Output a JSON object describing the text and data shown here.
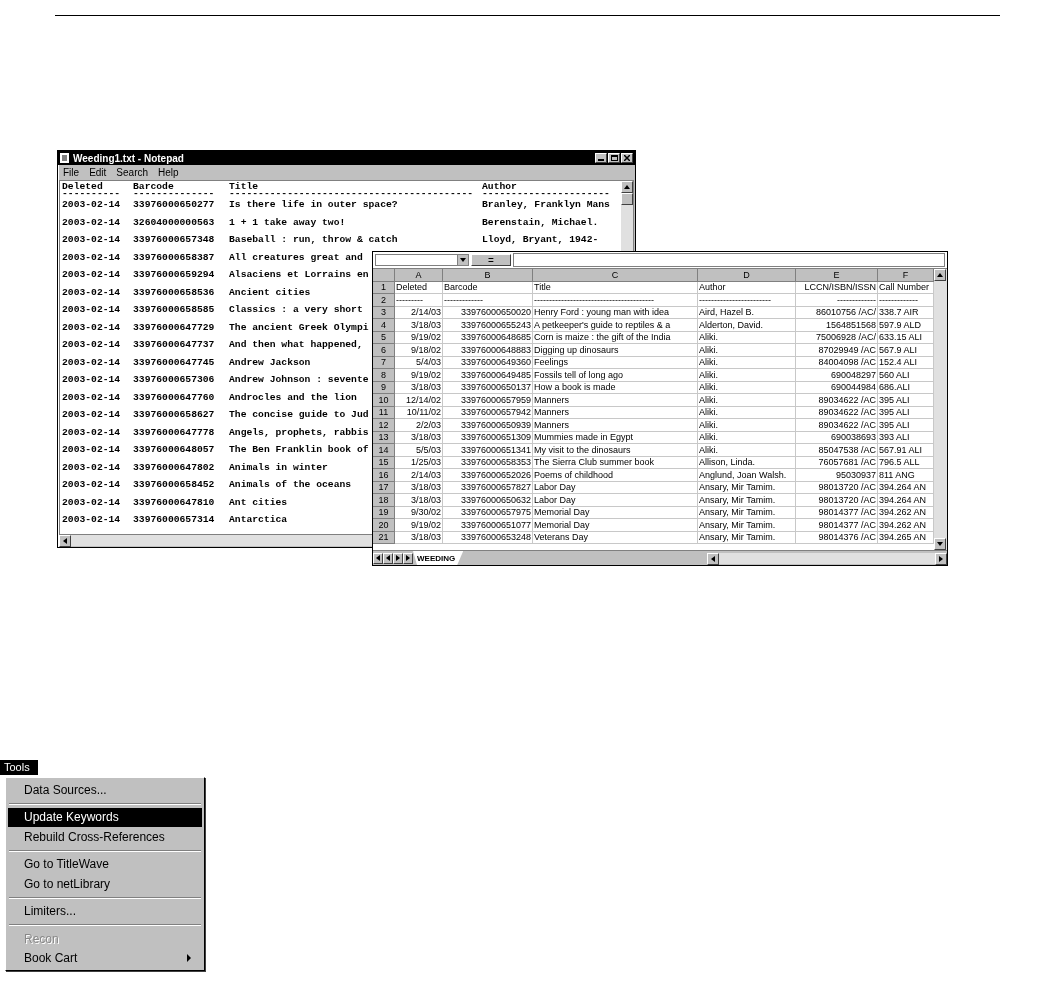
{
  "notepad": {
    "title": "Weeding1.txt - Notepad",
    "menu": [
      "File",
      "Edit",
      "Search",
      "Help"
    ],
    "columns": [
      {
        "label": "Deleted",
        "rule": "----------"
      },
      {
        "label": "Barcode",
        "rule": "--------------"
      },
      {
        "label": "Title",
        "rule": "------------------------------------------"
      },
      {
        "label": "Author",
        "rule": "----------------------"
      }
    ],
    "rows": [
      {
        "deleted": "2003-02-14",
        "barcode": "33976000650277",
        "title": "Is there life in outer space?",
        "author": "Branley, Franklyn Mans"
      },
      {
        "deleted": "2003-02-14",
        "barcode": "32604000000563",
        "title": "1 + 1 take away two!",
        "author": "Berenstain, Michael."
      },
      {
        "deleted": "2003-02-14",
        "barcode": "33976000657348",
        "title": "Baseball : run, throw & catch",
        "author": "Lloyd, Bryant, 1942-"
      },
      {
        "deleted": "2003-02-14",
        "barcode": "33976000658387",
        "title": "All creatures great and"
      },
      {
        "deleted": "2003-02-14",
        "barcode": "33976000659294",
        "title": "Alsaciens et Lorrains en"
      },
      {
        "deleted": "2003-02-14",
        "barcode": "33976000658536",
        "title": "Ancient cities"
      },
      {
        "deleted": "2003-02-14",
        "barcode": "33976000658585",
        "title": "Classics : a very short"
      },
      {
        "deleted": "2003-02-14",
        "barcode": "33976000647729",
        "title": "The ancient Greek Olympi"
      },
      {
        "deleted": "2003-02-14",
        "barcode": "33976000647737",
        "title": "And then what happened,"
      },
      {
        "deleted": "2003-02-14",
        "barcode": "33976000647745",
        "title": "Andrew Jackson"
      },
      {
        "deleted": "2003-02-14",
        "barcode": "33976000657306",
        "title": "Andrew Johnson : sevente"
      },
      {
        "deleted": "2003-02-14",
        "barcode": "33976000647760",
        "title": "Androcles and the lion"
      },
      {
        "deleted": "2003-02-14",
        "barcode": "33976000658627",
        "title": "The concise guide to Jud"
      },
      {
        "deleted": "2003-02-14",
        "barcode": "33976000647778",
        "title": "Angels, prophets, rabbis"
      },
      {
        "deleted": "2003-02-14",
        "barcode": "33976000648057",
        "title": "The Ben Franklin book of"
      },
      {
        "deleted": "2003-02-14",
        "barcode": "33976000647802",
        "title": "Animals in winter"
      },
      {
        "deleted": "2003-02-14",
        "barcode": "33976000658452",
        "title": "Animals of the oceans"
      },
      {
        "deleted": "2003-02-14",
        "barcode": "33976000647810",
        "title": "Ant cities"
      },
      {
        "deleted": "2003-02-14",
        "barcode": "33976000657314",
        "title": "Antarctica"
      }
    ]
  },
  "spreadsheet": {
    "formula_bar": {
      "equals": "="
    },
    "columns": [
      "A",
      "B",
      "C",
      "D",
      "E",
      "F"
    ],
    "rows": [
      {
        "num": "1",
        "cells": [
          "Deleted",
          "Barcode",
          "Title",
          "Author",
          "LCCN/ISBN/ISSN",
          "Call Number"
        ]
      },
      {
        "num": "2",
        "cells": [
          "---------",
          "-------------",
          "----------------------------------------",
          "------------------------",
          "-------------",
          "-------------"
        ]
      },
      {
        "num": "3",
        "cells": [
          "2/14/03",
          "33976000650020",
          "Henry Ford : young man with idea",
          "Aird, Hazel B.",
          "86010756 /AC/",
          "338.7 AIR"
        ]
      },
      {
        "num": "4",
        "cells": [
          "3/18/03",
          "33976000655243",
          "A petkeeper's guide to reptiles & a",
          "Alderton, David.",
          "1564851568",
          "597.9 ALD"
        ]
      },
      {
        "num": "5",
        "cells": [
          "9/19/02",
          "33976000648685",
          "Corn is maize : the gift of the India",
          "Aliki.",
          "75006928 /AC/",
          "633.15 ALI"
        ]
      },
      {
        "num": "6",
        "cells": [
          "9/18/02",
          "33976000648883",
          "Digging up dinosaurs",
          "Aliki.",
          "87029949 /AC",
          "567.9 ALI"
        ]
      },
      {
        "num": "7",
        "cells": [
          "5/4/03",
          "33976000649360",
          "Feelings",
          "Aliki.",
          "84004098 /AC",
          "152.4 ALI"
        ]
      },
      {
        "num": "8",
        "cells": [
          "9/19/02",
          "33976000649485",
          "Fossils tell of long ago",
          "Aliki.",
          "690048297",
          "560 ALI"
        ]
      },
      {
        "num": "9",
        "cells": [
          "3/18/03",
          "33976000650137",
          "How a book is made",
          "Aliki.",
          "690044984",
          "686.ALI"
        ]
      },
      {
        "num": "10",
        "cells": [
          "12/14/02",
          "33976000657959",
          "Manners",
          "Aliki.",
          "89034622 /AC",
          "395 ALI"
        ]
      },
      {
        "num": "11",
        "cells": [
          "10/11/02",
          "33976000657942",
          "Manners",
          "Aliki.",
          "89034622 /AC",
          "395 ALI"
        ]
      },
      {
        "num": "12",
        "cells": [
          "2/2/03",
          "33976000650939",
          "Manners",
          "Aliki.",
          "89034622 /AC",
          "395 ALI"
        ]
      },
      {
        "num": "13",
        "cells": [
          "3/18/03",
          "33976000651309",
          "Mummies made in Egypt",
          "Aliki.",
          "690038693",
          "393 ALI"
        ]
      },
      {
        "num": "14",
        "cells": [
          "5/5/03",
          "33976000651341",
          "My visit to the dinosaurs",
          "Aliki.",
          "85047538 /AC",
          "567.91 ALI"
        ]
      },
      {
        "num": "15",
        "cells": [
          "1/25/03",
          "33976000658353",
          "The Sierra Club summer book",
          "Allison, Linda.",
          "76057681 /AC",
          "796.5 ALL"
        ]
      },
      {
        "num": "16",
        "cells": [
          "2/14/03",
          "33976000652026",
          "Poems of childhood",
          "Anglund, Joan Walsh.",
          "95030937",
          "811 ANG"
        ]
      },
      {
        "num": "17",
        "cells": [
          "3/18/03",
          "33976000657827",
          "Labor Day",
          "Ansary, Mir Tamim.",
          "98013720 /AC",
          "394.264 AN"
        ]
      },
      {
        "num": "18",
        "cells": [
          "3/18/03",
          "33976000650632",
          "Labor Day",
          "Ansary, Mir Tamim.",
          "98013720 /AC",
          "394.264 AN"
        ]
      },
      {
        "num": "19",
        "cells": [
          "9/30/02",
          "33976000657975",
          "Memorial Day",
          "Ansary, Mir Tamim.",
          "98014377 /AC",
          "394.262 AN"
        ]
      },
      {
        "num": "20",
        "cells": [
          "9/19/02",
          "33976000651077",
          "Memorial Day",
          "Ansary, Mir Tamim.",
          "98014377 /AC",
          "394.262 AN"
        ]
      },
      {
        "num": "21",
        "cells": [
          "3/18/03",
          "33976000653248",
          "Veterans Day",
          "Ansary, Mir Tamim.",
          "98014376 /AC",
          "394.265 AN"
        ]
      }
    ],
    "sheet_tabs": [
      {
        "label": "WEEDING",
        "selected": true
      }
    ]
  },
  "menu": {
    "title": "Tools",
    "items": [
      {
        "kind": "item",
        "label": "Data Sources...",
        "selected": false,
        "disabled": false,
        "submenu": false
      },
      {
        "kind": "separator"
      },
      {
        "kind": "item",
        "label": "Update Keywords",
        "selected": true,
        "disabled": false,
        "submenu": false
      },
      {
        "kind": "item",
        "label": "Rebuild Cross-References",
        "selected": false,
        "disabled": false,
        "submenu": false
      },
      {
        "kind": "separator"
      },
      {
        "kind": "item",
        "label": "Go to TitleWave",
        "selected": false,
        "disabled": false,
        "submenu": false
      },
      {
        "kind": "item",
        "label": "Go to netLibrary",
        "selected": false,
        "disabled": false,
        "submenu": false
      },
      {
        "kind": "separator"
      },
      {
        "kind": "item",
        "label": "Limiters...",
        "selected": false,
        "disabled": false,
        "submenu": false
      },
      {
        "kind": "separator"
      },
      {
        "kind": "item",
        "label": "Recon",
        "selected": false,
        "disabled": true,
        "submenu": false
      },
      {
        "kind": "item",
        "label": "Book Cart",
        "selected": false,
        "disabled": false,
        "submenu": true
      }
    ]
  }
}
